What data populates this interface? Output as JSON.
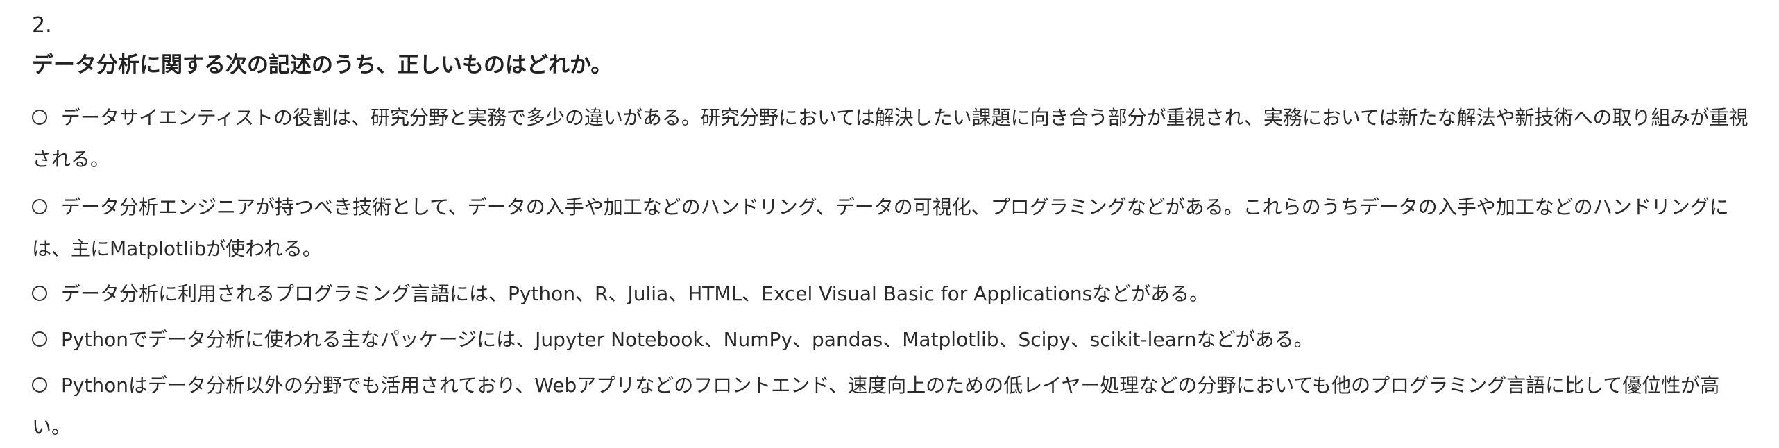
{
  "question": {
    "number": "2.",
    "text": "データ分析に関する次の記述のうち、正しいものはどれか。"
  },
  "options": [
    {
      "label": "データサイエンティストの役割は、研究分野と実務で多少の違いがある。研究分野においては解決したい課題に向き合う部分が重視され、実務においては新たな解法や新技術への取り組みが重視される。"
    },
    {
      "label": "データ分析エンジニアが持つべき技術として、データの入手や加工などのハンドリング、データの可視化、プログラミングなどがある。これらのうちデータの入手や加工などのハンドリングには、主にMatplotlibが使われる。"
    },
    {
      "label": "データ分析に利用されるプログラミング言語には、Python、R、Julia、HTML、Excel Visual Basic for Applicationsなどがある。"
    },
    {
      "label": "Pythonでデータ分析に使われる主なパッケージには、Jupyter Notebook、NumPy、pandas、Matplotlib、Scipy、scikit-learnなどがある。"
    },
    {
      "label": "Pythonはデータ分析以外の分野でも活用されており、Webアプリなどのフロントエンド、速度向上のための低レイヤー処理などの分野においても他のプログラミング言語に比して優位性が高い。"
    }
  ]
}
